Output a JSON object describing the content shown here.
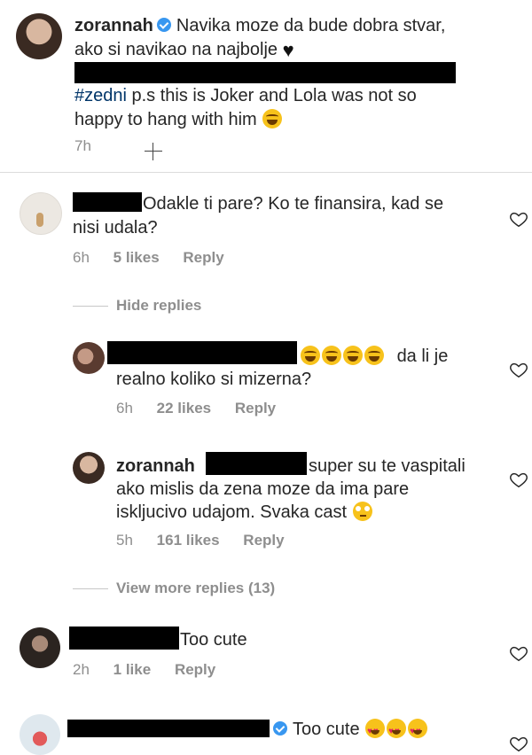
{
  "post": {
    "username": "zorannah",
    "text_line1": "Navika moze da bude dobra stvar,",
    "text_line2": "ako si navikao na najbolje",
    "hashtag": "#zedni",
    "text_line4_rest": "p.s this is Joker and Lola was not so",
    "text_line5": "happy to hang with him",
    "time": "7h"
  },
  "comments": [
    {
      "text_line1": "Odakle ti pare? Ko te finansira, kad se",
      "text_line2": "nisi udala?",
      "time": "6h",
      "likes": "5 likes",
      "reply": "Reply",
      "hide_replies": "Hide replies"
    },
    {
      "text_tail": "da li je",
      "text_line2": "realno koliko si mizerna?",
      "time": "6h",
      "likes": "22 likes",
      "reply": "Reply"
    },
    {
      "username": "zorannah",
      "text_line1": "super su te vaspitali",
      "text_line2": "ako mislis da zena moze da ima pare",
      "text_line3": "iskljucivo udajom. Svaka cast",
      "time": "5h",
      "likes": "161 likes",
      "reply": "Reply",
      "view_more": "View more replies (13)"
    },
    {
      "text_line1": "Too cute",
      "time": "2h",
      "likes": "1 like",
      "reply": "Reply"
    },
    {
      "text_line1": "Too cute"
    }
  ],
  "icons": {
    "heart": "heart-outline-icon",
    "verified": "verified-badge-icon"
  },
  "colors": {
    "meta": "#8e8e8e",
    "verified": "#3897f0",
    "hashtag": "#003569"
  }
}
